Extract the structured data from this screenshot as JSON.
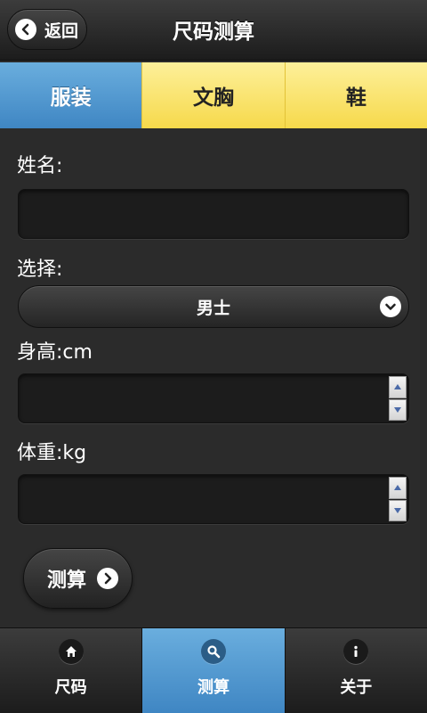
{
  "header": {
    "back_label": "返回",
    "title": "尺码测算"
  },
  "tabs": [
    {
      "label": "服装",
      "active": true
    },
    {
      "label": "文胸",
      "active": false
    },
    {
      "label": "鞋",
      "active": false
    }
  ],
  "form": {
    "name_label": "姓名:",
    "name_value": "",
    "select_label": "选择:",
    "select_value": "男士",
    "height_label": "身高:cm",
    "height_value": "",
    "weight_label": "体重:kg",
    "weight_value": ""
  },
  "calc_button": {
    "label": "测算"
  },
  "bottom_nav": [
    {
      "label": "尺码",
      "icon": "home-icon",
      "active": false
    },
    {
      "label": "测算",
      "icon": "search-icon",
      "active": true
    },
    {
      "label": "关于",
      "icon": "info-icon",
      "active": false
    }
  ],
  "colors": {
    "accent_blue": "#4f96cf",
    "tab_yellow": "#f8e06a",
    "background": "#2b2b2b"
  }
}
